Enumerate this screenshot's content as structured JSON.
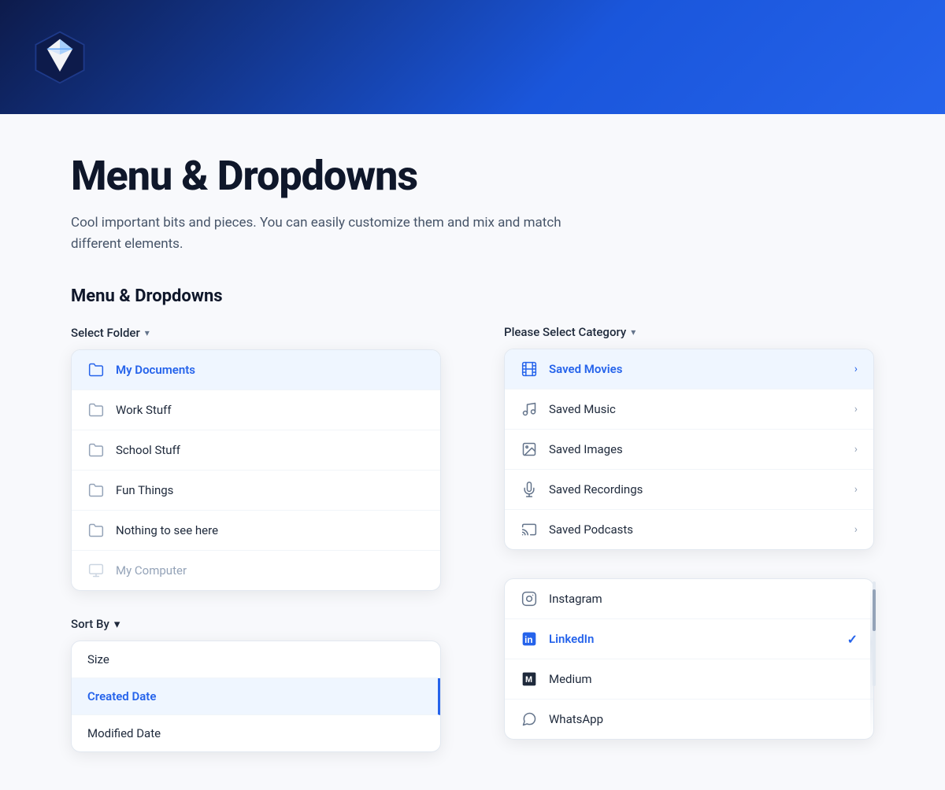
{
  "header": {
    "logo_alt": "Diamond Logo"
  },
  "page": {
    "title": "Menu & Dropdowns",
    "subtitle": "Cool important bits and pieces. You can easily customize them and mix and match different elements.",
    "section_label": "Menu & Dropdowns"
  },
  "left_column": {
    "folder_dropdown": {
      "trigger_label": "Select Folder",
      "items": [
        {
          "id": "my-documents",
          "label": "My Documents",
          "active": true,
          "disabled": false
        },
        {
          "id": "work-stuff",
          "label": "Work Stuff",
          "active": false,
          "disabled": false
        },
        {
          "id": "school-stuff",
          "label": "School Stuff",
          "active": false,
          "disabled": false
        },
        {
          "id": "fun-things",
          "label": "Fun Things",
          "active": false,
          "disabled": false
        },
        {
          "id": "nothing-to-see-here",
          "label": "Nothing to see here",
          "active": false,
          "disabled": false
        },
        {
          "id": "my-computer",
          "label": "My Computer",
          "active": false,
          "disabled": true
        }
      ]
    },
    "sort_dropdown": {
      "trigger_label": "Sort By",
      "items": [
        {
          "id": "size",
          "label": "Size",
          "active": false
        },
        {
          "id": "created-date",
          "label": "Created Date",
          "active": true
        },
        {
          "id": "modified-date",
          "label": "Modified Date",
          "active": false
        }
      ]
    }
  },
  "right_column": {
    "category_dropdown": {
      "trigger_label": "Please Select Category",
      "items": [
        {
          "id": "saved-movies",
          "label": "Saved Movies",
          "active": true,
          "icon": "film"
        },
        {
          "id": "saved-music",
          "label": "Saved Music",
          "active": false,
          "icon": "music"
        },
        {
          "id": "saved-images",
          "label": "Saved Images",
          "active": false,
          "icon": "image"
        },
        {
          "id": "saved-recordings",
          "label": "Saved Recordings",
          "active": false,
          "icon": "mic"
        },
        {
          "id": "saved-podcasts",
          "label": "Saved Podcasts",
          "active": false,
          "icon": "cast"
        }
      ]
    },
    "social_dropdown": {
      "items": [
        {
          "id": "instagram",
          "label": "Instagram",
          "active": false
        },
        {
          "id": "linkedin",
          "label": "LinkedIn",
          "active": true
        },
        {
          "id": "medium",
          "label": "Medium",
          "active": false
        },
        {
          "id": "whatsapp",
          "label": "WhatsApp",
          "active": false
        }
      ]
    }
  },
  "icons": {
    "chevron_down": "▾",
    "chevron_right": "›",
    "check": "✓",
    "folder": "folder",
    "film": "film",
    "music": "music",
    "image": "image",
    "mic": "mic",
    "cast": "cast"
  }
}
